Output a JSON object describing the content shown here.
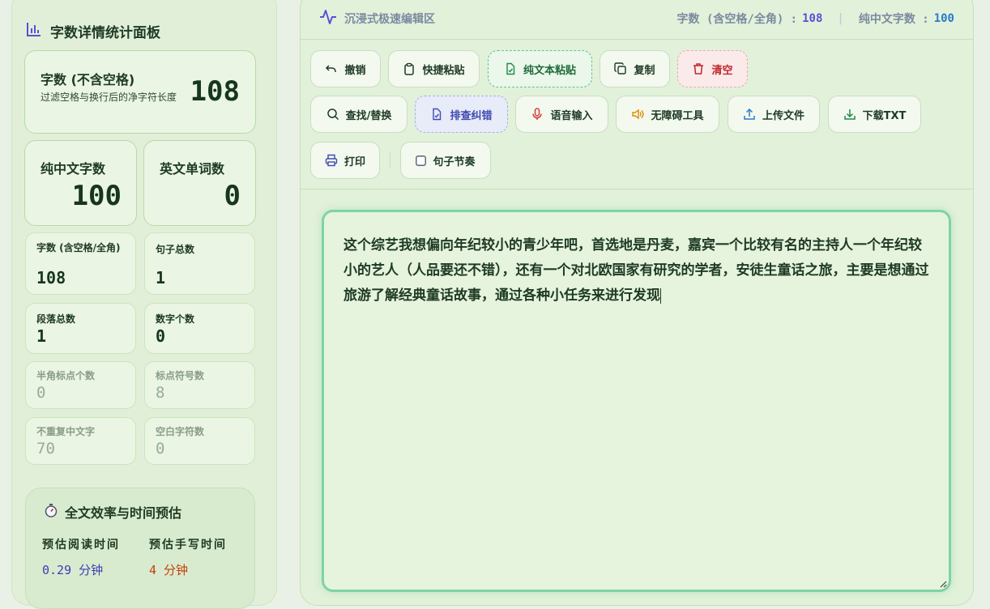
{
  "sidebar": {
    "title": "字数详情统计面板",
    "main_card": {
      "label": "字数 (不含空格)",
      "desc": "过滤空格与换行后的净字符长度",
      "value": "108"
    },
    "pure_cn": {
      "label": "纯中文字数",
      "value": "100"
    },
    "en_words": {
      "label": "英文单词数",
      "value": "0"
    },
    "stats": [
      {
        "label": "字数 (含空格/全角)",
        "value": "108"
      },
      {
        "label": "句子总数",
        "value": "1"
      },
      {
        "label": "段落总数",
        "value": "1"
      },
      {
        "label": "数字个数",
        "value": "0"
      },
      {
        "label": "半角标点个数",
        "value": "0"
      },
      {
        "label": "标点符号数",
        "value": "8"
      },
      {
        "label": "不重复中文字",
        "value": "70"
      },
      {
        "label": "空白字符数",
        "value": "0"
      }
    ],
    "efficiency": {
      "title": "全文效率与时间预估",
      "read_label": "预估阅读时间",
      "read_value": "0.29 分钟",
      "write_label": "预估手写时间",
      "write_value": "4 分钟"
    }
  },
  "topbar": {
    "zone_label": "沉浸式极速编辑区",
    "count_full_label": "字数 (含空格/全角) :",
    "count_full_value": "108",
    "count_cn_label": "纯中文字数 :",
    "count_cn_value": "100"
  },
  "toolbar": {
    "undo": "撤销",
    "quick_paste": "快捷粘贴",
    "plain_paste": "纯文本粘贴",
    "copy": "复制",
    "clear": "清空",
    "find_replace": "查找/替换",
    "typo_check": "排查纠错",
    "voice_input": "语音输入",
    "accessibility": "无障碍工具",
    "upload": "上传文件",
    "download": "下载TXT",
    "print": "打印",
    "sentence_rhythm": "句子节奏"
  },
  "editor": {
    "content": "这个综艺我想偏向年纪较小的青少年吧，首选地是丹麦，嘉宾一个比较有名的主持人一个年纪较小的艺人（人品要还不错），还有一个对北欧国家有研究的学者，安徒生童话之旅，主要是想通过旅游了解经典童话故事，通过各种小任务来进行发现"
  },
  "colors": {
    "accent_green": "#5fc48a",
    "danger": "#c0262d",
    "indigo": "#3f4bb0",
    "read_time": "#3b3fb5",
    "write_time": "#c2410c",
    "count_num": "#2b7cc9"
  }
}
